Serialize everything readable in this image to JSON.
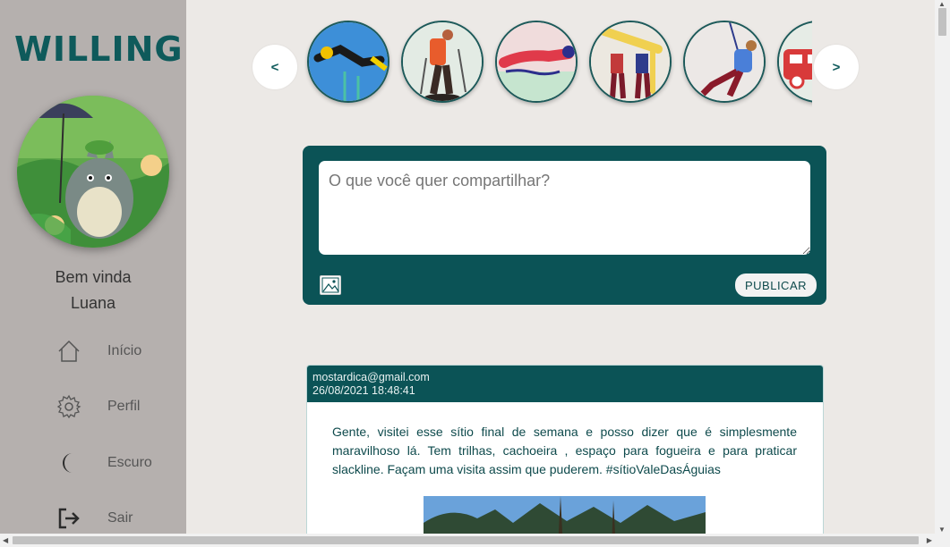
{
  "app": {
    "logo_text": "WILLING"
  },
  "user": {
    "greeting": "Bem vinda",
    "name": "Luana"
  },
  "nav": [
    {
      "label": "Início",
      "icon": "home-icon"
    },
    {
      "label": "Perfil",
      "icon": "gear-icon"
    },
    {
      "label": "Escuro",
      "icon": "moon-icon"
    },
    {
      "label": "Sair",
      "icon": "logout-icon"
    }
  ],
  "carousel": {
    "prev_label": "<",
    "next_label": ">",
    "categories": [
      {
        "icon": "diving-icon"
      },
      {
        "icon": "hiking-icon"
      },
      {
        "icon": "swimming-icon"
      },
      {
        "icon": "surfing-icon"
      },
      {
        "icon": "climbing-icon"
      },
      {
        "icon": "camper-van-icon"
      }
    ]
  },
  "composer": {
    "placeholder": "O que você quer compartilhar?",
    "value": "",
    "publish_label": "PUBLICAR"
  },
  "post": {
    "author": "mostardica@gmail.com",
    "timestamp": "26/08/2021 18:48:41",
    "text": "Gente, visitei esse sítio final de semana e posso dizer que é simplesmente maravilhoso lá. Tem trilhas, cachoeira , espaço para fogueira e para praticar slackline. Façam uma visita assim que puderem. #sítioValeDasÁguias"
  },
  "colors": {
    "primary": "#0b5356",
    "sidebar": "#b5b0ae",
    "background": "#ece9e6"
  }
}
